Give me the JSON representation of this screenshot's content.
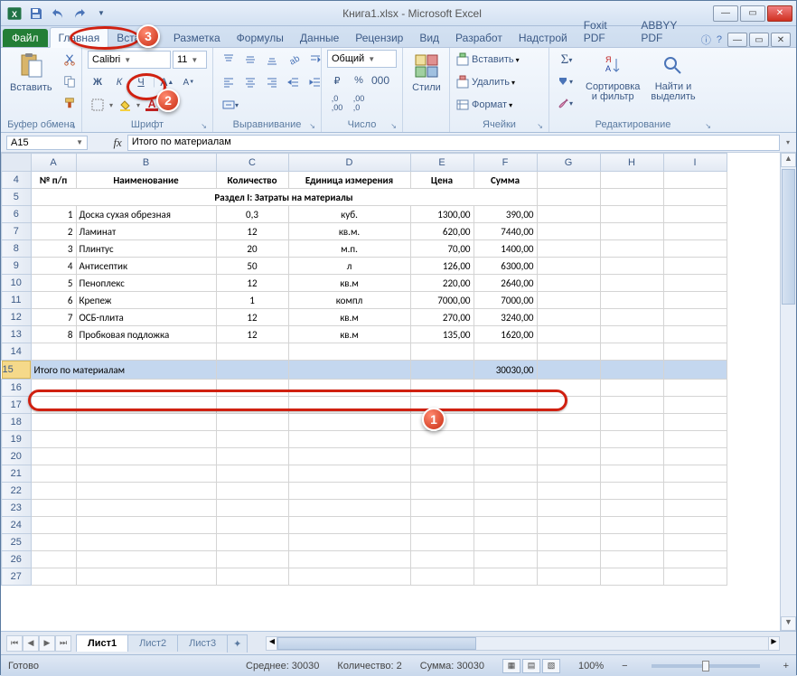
{
  "title": "Книга1.xlsx - Microsoft Excel",
  "qat": {
    "save": "save-icon",
    "undo": "undo-icon",
    "redo": "redo-icon"
  },
  "tabs": {
    "file": "Файл",
    "items": [
      "Главная",
      "Вставка",
      "Разметка",
      "Формулы",
      "Данные",
      "Рецензир",
      "Вид",
      "Разработ",
      "Надстрой",
      "Foxit PDF",
      "ABBYY PDF"
    ],
    "active": 0
  },
  "ribbon": {
    "clipboard": {
      "paste": "Вставить",
      "label": "Буфер обмена"
    },
    "font": {
      "name": "Calibri",
      "size": "11",
      "bold": "Ж",
      "italic": "К",
      "underline": "Ч",
      "label": "Шрифт"
    },
    "alignment": {
      "label": "Выравнивание"
    },
    "number": {
      "format": "Общий",
      "label": "Число"
    },
    "styles": {
      "btn": "Стили",
      "label": "Стили"
    },
    "cells": {
      "insert": "Вставить",
      "delete": "Удалить",
      "format": "Формат",
      "label": "Ячейки"
    },
    "editing": {
      "sort": "Сортировка\nи фильтр",
      "find": "Найти и\nвыделить",
      "label": "Редактирование"
    }
  },
  "formula": {
    "name_box": "A15",
    "fx": "fx",
    "content": "Итого по материалам"
  },
  "columns": [
    "A",
    "B",
    "C",
    "D",
    "E",
    "F",
    "G",
    "H",
    "I"
  ],
  "first_row_index": 4,
  "selected_row": 15,
  "headers": {
    "a": "№ п/п",
    "b": "Наименование",
    "c": "Количество",
    "d": "Единица измерения",
    "e": "Цена",
    "f": "Сумма"
  },
  "section_title": "Раздел I: Затраты на материалы",
  "rows": [
    {
      "n": "1",
      "name": "Доска сухая обрезная",
      "qty": "0,3",
      "unit": "куб.",
      "price": "1300,00",
      "sum": "390,00"
    },
    {
      "n": "2",
      "name": "Ламинат",
      "qty": "12",
      "unit": "кв.м.",
      "price": "620,00",
      "sum": "7440,00"
    },
    {
      "n": "3",
      "name": "Плинтус",
      "qty": "20",
      "unit": "м.п.",
      "price": "70,00",
      "sum": "1400,00"
    },
    {
      "n": "4",
      "name": "Антисептик",
      "qty": "50",
      "unit": "л",
      "price": "126,00",
      "sum": "6300,00"
    },
    {
      "n": "5",
      "name": "Пеноплекс",
      "qty": "12",
      "unit": "кв.м",
      "price": "220,00",
      "sum": "2640,00"
    },
    {
      "n": "6",
      "name": "Крепеж",
      "qty": "1",
      "unit": "компл",
      "price": "7000,00",
      "sum": "7000,00"
    },
    {
      "n": "7",
      "name": "ОСБ-плита",
      "qty": "12",
      "unit": "кв.м",
      "price": "270,00",
      "sum": "3240,00"
    },
    {
      "n": "8",
      "name": "Пробковая подложка",
      "qty": "12",
      "unit": "кв.м",
      "price": "135,00",
      "sum": "1620,00"
    }
  ],
  "total": {
    "label": "Итого по материалам",
    "sum": "30030,00"
  },
  "sheets": {
    "items": [
      "Лист1",
      "Лист2",
      "Лист3"
    ],
    "active": 0
  },
  "status": {
    "ready": "Готово",
    "avg": "Среднее: 30030",
    "count": "Количество: 2",
    "sum": "Сумма: 30030",
    "zoom": "100%"
  },
  "callouts": {
    "c1": "1",
    "c2": "2",
    "c3": "3"
  }
}
